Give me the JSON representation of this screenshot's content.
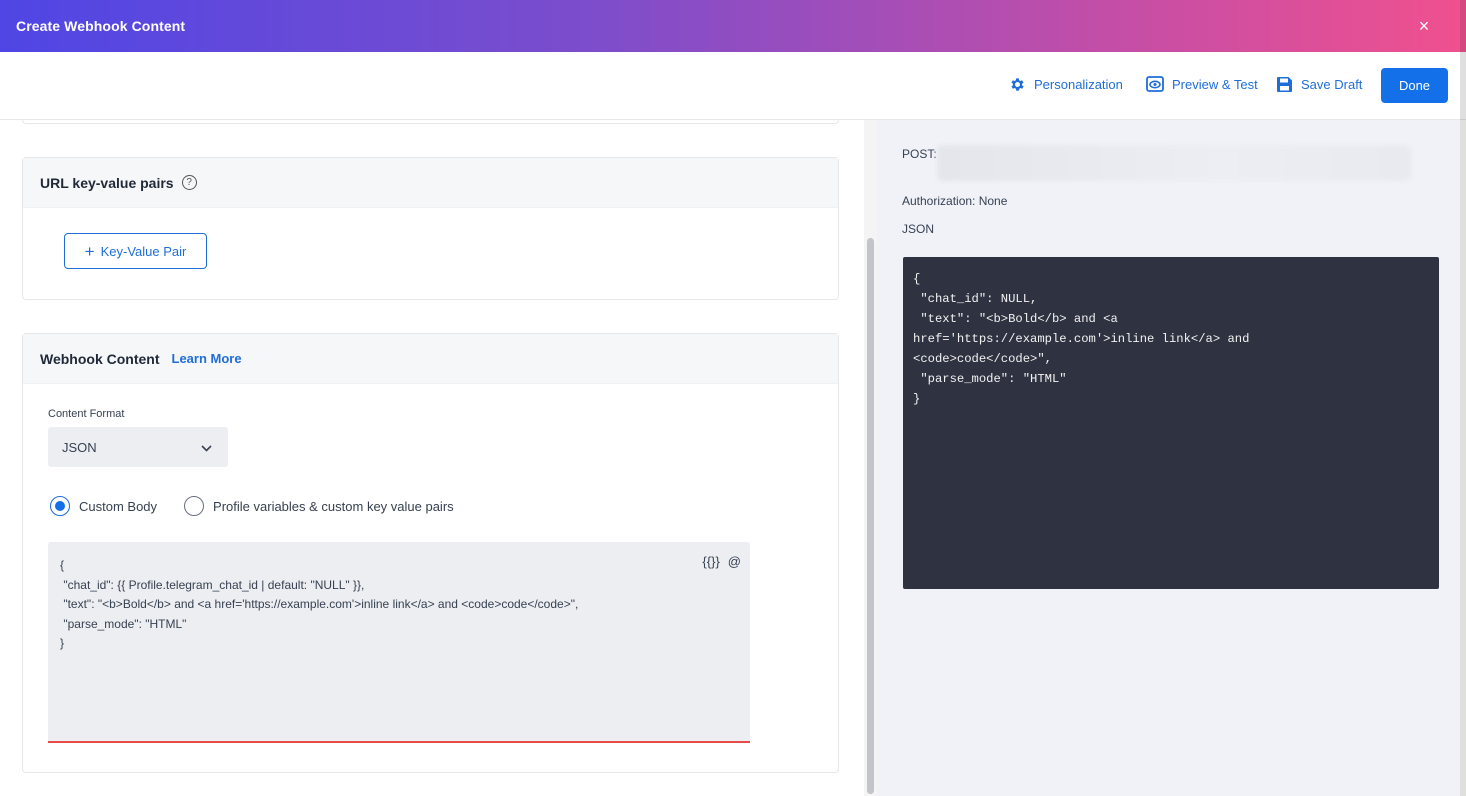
{
  "header": {
    "title": "Create Webhook Content",
    "close_symbol": "×"
  },
  "toolbar": {
    "personalization": "Personalization",
    "preview_test": "Preview & Test",
    "save_draft": "Save Draft",
    "done": "Done"
  },
  "url_pairs": {
    "title": "URL key-value pairs",
    "help_symbol": "?",
    "add_button": "Key-Value Pair",
    "add_symbol": "+"
  },
  "webhook_content": {
    "title": "Webhook Content",
    "learn_more": "Learn More",
    "content_format_label": "Content Format",
    "content_format_value": "JSON",
    "radio_custom_body": "Custom Body",
    "radio_profile_vars": "Profile variables & custom key value pairs",
    "selected_radio": "Custom Body",
    "editor_tool_braces": "{{}}",
    "editor_tool_at": "@",
    "editor_lines": [
      "{",
      " \"chat_id\": {{ Profile.telegram_chat_id | default: \"NULL\" }},",
      " \"text\": \"<b>Bold</b> and <a href='https://example.com'>inline link</a> and <code>code</code>\",",
      " \"parse_mode\": \"HTML\"",
      "}"
    ]
  },
  "preview": {
    "method": "POST:",
    "authorization": "Authorization: None",
    "format": "JSON",
    "code_lines": [
      "{",
      " \"chat_id\": NULL,",
      " \"text\": \"<b>Bold</b> and <a",
      "href='https://example.com'>inline link</a> and",
      "<code>code</code>\",",
      " \"parse_mode\": \"HTML\"",
      "}"
    ]
  },
  "colors": {
    "accent": "#1470e8",
    "link": "#1f6ed8",
    "header_gradient_start": "#4f46e5",
    "header_gradient_end": "#f0508e",
    "code_bg": "#2f3341",
    "editor_underline": "#e84a4a"
  },
  "icons": {
    "personalization": "gear-icon",
    "preview": "eye-icon",
    "save_draft": "save-icon",
    "close": "close-icon",
    "select": "chevron-down-icon"
  }
}
